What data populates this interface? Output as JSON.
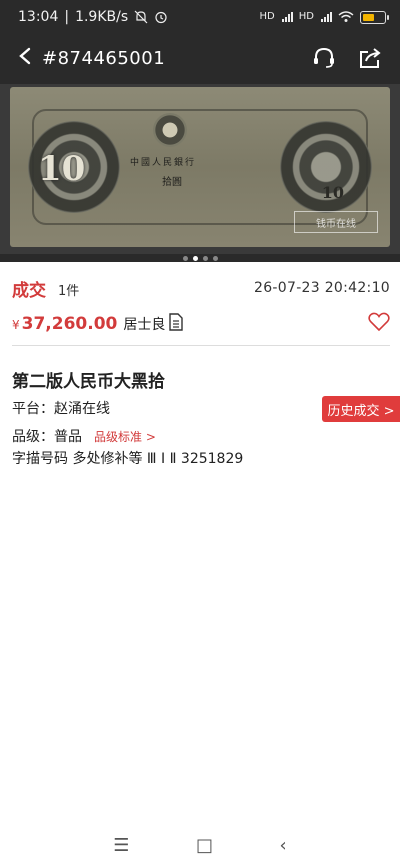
{
  "status_bar": {
    "time": "13:04",
    "speed": "1.9KB/s",
    "signal1": "HD",
    "signal2": "HD",
    "icons": [
      "mute-bell-icon",
      "alarm-icon",
      "wifi-icon",
      "battery-icon"
    ]
  },
  "nav": {
    "title": "#874465001",
    "icons": [
      "back-icon",
      "headset-icon",
      "share-icon"
    ]
  },
  "banner": {
    "denomination": "10",
    "small_denomination": "10",
    "bank_name": "中國人民銀行",
    "yuan_label": "拾圓",
    "watermark": "钱币在线",
    "dots_total": 4,
    "dots_active_index": 1
  },
  "deal": {
    "label": "成交",
    "count": "1件",
    "time": "26-07-23 20:42:10"
  },
  "price": {
    "currency": "¥",
    "amount": "37,260.00",
    "seller": "居士良"
  },
  "item": {
    "title": "第二版人民币大黑拾",
    "platform": "平台：赵涌在线",
    "history_button": "历史成交 >",
    "grade": "品级：普品",
    "grade_standard": "品级标准 >",
    "description": "字描号码 多处修补等 Ⅲ Ⅰ Ⅱ 3251829"
  },
  "bottom_nav": {
    "menu": "☰",
    "home": "□",
    "back": "‹"
  },
  "colors": {
    "accent": "#d23b3b",
    "header_bg": "#2a2a2a"
  }
}
